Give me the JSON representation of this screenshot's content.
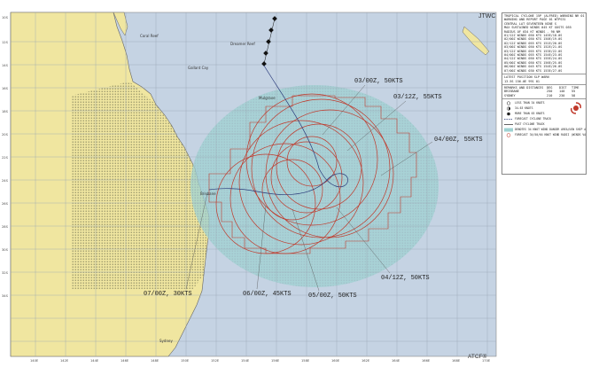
{
  "header": {
    "agency": "JTWC",
    "system": "ATCF®"
  },
  "forecast_labels": [
    {
      "text": "03/00Z, 50KTS"
    },
    {
      "text": "03/12Z, 55KTS"
    },
    {
      "text": "04/00Z, 55KTS"
    },
    {
      "text": "04/12Z, 50KTS"
    },
    {
      "text": "05/00Z, 50KTS"
    },
    {
      "text": "06/00Z, 45KTS"
    },
    {
      "text": "07/00Z, 30KTS"
    }
  ],
  "place_labels": [
    {
      "text": "Coral Reef"
    },
    {
      "text": "Dreamer Reef"
    },
    {
      "text": "Gallant Cay"
    },
    {
      "text": "Mulgrave"
    },
    {
      "text": "Brisbane"
    },
    {
      "text": "Sydney"
    }
  ],
  "lat_ticks": [
    "10S",
    "12S",
    "14S",
    "16S",
    "18S",
    "20S",
    "22S",
    "24S",
    "26S",
    "28S",
    "30S",
    "32S",
    "34S"
  ],
  "lon_ticks": [
    "140E",
    "142E",
    "144E",
    "146E",
    "148E",
    "150E",
    "152E",
    "154E",
    "156E",
    "158E",
    "160E",
    "162E",
    "164E",
    "166E",
    "168E",
    "170E"
  ],
  "info_panel": {
    "warning_lines": [
      "TROPICAL CYCLONE 15P (ALFRED) WARNING NR 01",
      "WARNING AND REPORT PAGE 01 WTPS31",
      "CENTRAL LAT SEVENTEEN NINE S",
      "MAX SUSTAINED WINDS 045 KT GUSTS 055",
      "RADIUS OF 034 KT WINDS - 90 NM",
      "01/12Z WINDS 050 KTS 145E/18.0S",
      "02/00Z WINDS 050 KTS 150E/19.0S",
      "02/12Z WINDS 055 KTS 151E/20.0S",
      "03/00Z WINDS 050 KTS 152E/21.0S",
      "03/12Z WINDS 055 KTS 153E/22.0S",
      "04/00Z WINDS 055 KTS 154E/23.0S",
      "04/12Z WINDS 050 KTS 155E/24.0S",
      "05/00Z WINDS 050 KTS 156E/25.0S",
      "06/00Z WINDS 045 KTS 154E/26.0S",
      "07/00Z WINDS 030 KTS 153E/27.0S"
    ],
    "position_lines": [
      "LATEST POSITION  SLP  WARN",
      "13.5S 156.0E     991  01"
    ],
    "distance_rows": [
      [
        "REMARKS AND DISTANCES",
        "DEG",
        "DIST",
        "TIME"
      ],
      [
        "BRISBANE",
        "250",
        "140",
        "55"
      ],
      [
        "SYDNEY",
        "210",
        "230",
        "58"
      ]
    ],
    "legend": [
      {
        "label": "LESS THAN 34 KNOTS",
        "sym": "ring"
      },
      {
        "label": "34-63 KNOTS",
        "sym": "half"
      },
      {
        "label": "MORE THAN 63 KNOTS",
        "sym": "filled"
      },
      {
        "label": "FORECAST CYCLONE TRACK",
        "sym": "dash"
      },
      {
        "label": "PAST CYCLONE TRACK",
        "sym": "solid"
      },
      {
        "label": "DENOTES 34 KNOT WIND DANGER AREA/USN SHIP AVOIDANCE AREA",
        "sym": "area"
      },
      {
        "label": "FORECAST 34/50/64 KNOT WIND RADII (WINDS VALID OVER OPEN OCEAN ONLY)",
        "sym": "radii"
      }
    ],
    "colors": {
      "ocean": "#c5d3e3",
      "land": "#f0e6a0",
      "danger": "#9ed2d2",
      "radii": "#c0392b",
      "track": "#2a3a7a"
    }
  }
}
